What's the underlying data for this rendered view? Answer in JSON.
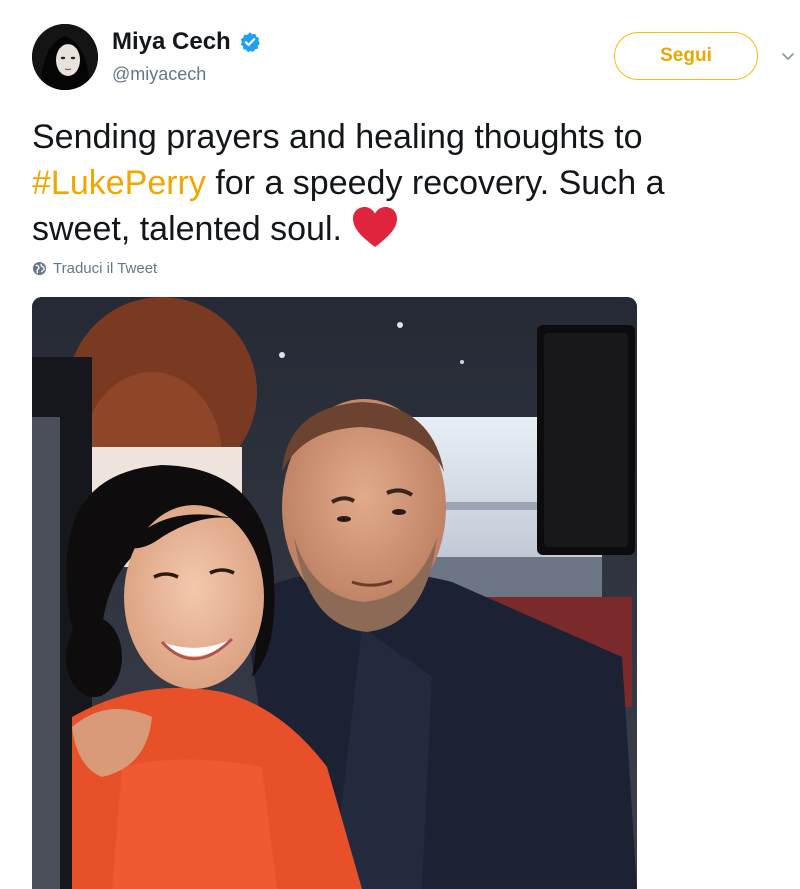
{
  "author": {
    "name": "Miya Cech",
    "handle": "@miyacech",
    "verified": true,
    "avatar_icon": "avatar-photo"
  },
  "follow_button": {
    "label": "Segui"
  },
  "tweet": {
    "text_before": "Sending prayers and healing thoughts to ",
    "hashtag": "#LukePerry",
    "text_after": " for a speedy recovery. Such a sweet, talented soul.",
    "emoji": "red-heart-icon"
  },
  "translate": {
    "label": "Traduci il Tweet",
    "icon": "globe-icon"
  },
  "media": {
    "type": "photo",
    "icon": "tweet-photo"
  },
  "colors": {
    "accent": "#f0a800",
    "verified": "#1da1f2",
    "secondary_text": "#657786",
    "heart": "#e0243e"
  }
}
